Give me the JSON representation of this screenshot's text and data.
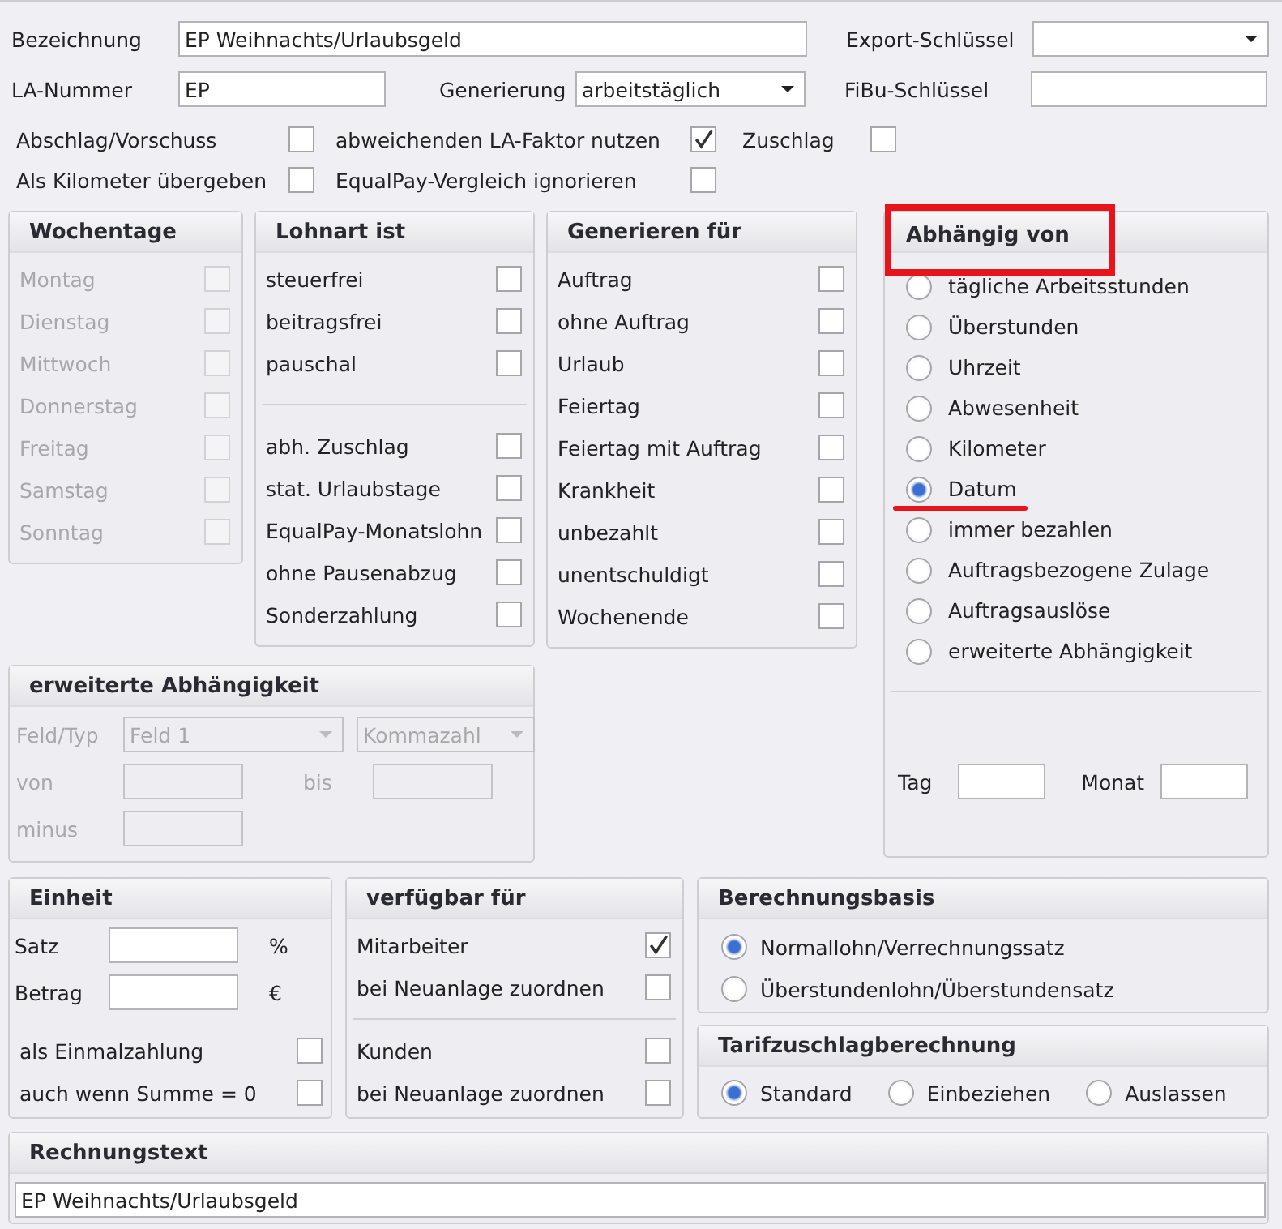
{
  "top": {
    "bezeichnung": {
      "label": "Bezeichnung",
      "value": "EP Weihnachts/Urlaubsgeld"
    },
    "export_schluessel": {
      "label": "Export-Schlüssel"
    },
    "la_nummer": {
      "label": "LA-Nummer",
      "value": "EP"
    },
    "generierung": {
      "label": "Generierung",
      "value": "arbeitstäglich"
    },
    "fibu_schluessel": {
      "label": "FiBu-Schlüssel"
    },
    "options": [
      {
        "label": "Abschlag/Vorschuss",
        "checked": false
      },
      {
        "label": "abweichenden LA-Faktor nutzen",
        "checked": true
      },
      {
        "label": "Zuschlag",
        "checked": false
      },
      {
        "label": "Als Kilometer übergeben",
        "checked": false
      },
      {
        "label": "EqualPay-Vergleich ignorieren",
        "checked": false
      }
    ]
  },
  "wochentage": {
    "title": "Wochentage",
    "items": [
      {
        "label": "Montag",
        "checked": false,
        "disabled": true
      },
      {
        "label": "Dienstag",
        "checked": false,
        "disabled": true
      },
      {
        "label": "Mittwoch",
        "checked": false,
        "disabled": true
      },
      {
        "label": "Donnerstag",
        "checked": false,
        "disabled": true
      },
      {
        "label": "Freitag",
        "checked": false,
        "disabled": true
      },
      {
        "label": "Samstag",
        "checked": false,
        "disabled": true
      },
      {
        "label": "Sonntag",
        "checked": false,
        "disabled": true
      }
    ]
  },
  "lohnart_ist": {
    "title": "Lohnart ist",
    "sections": [
      {
        "items": [
          {
            "label": "steuerfrei",
            "checked": false,
            "disabled": false
          },
          {
            "label": "beitragsfrei",
            "checked": false,
            "disabled": false
          },
          {
            "label": "pauschal",
            "checked": false,
            "disabled": false
          }
        ]
      },
      {
        "items": [
          {
            "label": "abh. Zuschlag",
            "checked": false,
            "disabled": false
          },
          {
            "label": "stat. Urlaubstage",
            "checked": false,
            "disabled": false
          },
          {
            "label": "EqualPay-Monatslohn",
            "checked": false,
            "disabled": false
          },
          {
            "label": "ohne Pausenabzug",
            "checked": false,
            "disabled": false
          },
          {
            "label": "Sonderzahlung",
            "checked": false,
            "disabled": false
          }
        ]
      }
    ]
  },
  "generieren_fuer": {
    "title": "Generieren für",
    "items": [
      {
        "label": "Auftrag",
        "checked": false,
        "disabled": false
      },
      {
        "label": "ohne Auftrag",
        "checked": false,
        "disabled": false
      },
      {
        "label": "Urlaub",
        "checked": false,
        "disabled": false
      },
      {
        "label": "Feiertag",
        "checked": false,
        "disabled": false
      },
      {
        "label": "Feiertag mit Auftrag",
        "checked": false,
        "disabled": false
      },
      {
        "label": "Krankheit",
        "checked": false,
        "disabled": false
      },
      {
        "label": "unbezahlt",
        "checked": false,
        "disabled": false
      },
      {
        "label": "unentschuldigt",
        "checked": false,
        "disabled": false
      },
      {
        "label": "Wochenende",
        "checked": false,
        "disabled": false
      }
    ]
  },
  "abhaengig_von": {
    "title": "Abhängig von",
    "title_highlighted": true,
    "options": [
      {
        "label": "tägliche Arbeitsstunden",
        "selected": false,
        "underlined": false
      },
      {
        "label": "Überstunden",
        "selected": false,
        "underlined": false
      },
      {
        "label": "Uhrzeit",
        "selected": false,
        "underlined": false
      },
      {
        "label": "Abwesenheit",
        "selected": false,
        "underlined": false
      },
      {
        "label": "Kilometer",
        "selected": false,
        "underlined": false
      },
      {
        "label": "Datum",
        "selected": true,
        "underlined": true
      },
      {
        "label": "immer bezahlen",
        "selected": false,
        "underlined": false
      },
      {
        "label": "Auftragsbezogene Zulage",
        "selected": false,
        "underlined": false
      },
      {
        "label": "Auftragsauslöse",
        "selected": false,
        "underlined": false
      },
      {
        "label": "erweiterte Abhängigkeit",
        "selected": false,
        "underlined": false
      }
    ],
    "tag": {
      "label": "Tag"
    },
    "monat": {
      "label": "Monat"
    }
  },
  "erweiterte_abhaengigkeit": {
    "title": "erweiterte Abhängigkeit",
    "disabled": true,
    "feld_typ_label": "Feld/Typ",
    "feld": "Feld 1",
    "typ": "Kommazahl",
    "von_label": "von",
    "bis_label": "bis",
    "minus_label": "minus"
  },
  "einheit": {
    "title": "Einheit",
    "satz": {
      "label": "Satz",
      "unit": "%"
    },
    "betrag": {
      "label": "Betrag",
      "unit": "€"
    },
    "items": [
      {
        "label": "als Einmalzahlung",
        "checked": false,
        "disabled": false
      },
      {
        "label": "auch wenn Summe = 0",
        "checked": false,
        "disabled": false
      }
    ]
  },
  "verfuegbar_fuer": {
    "title": "verfügbar für",
    "sections": [
      {
        "items": [
          {
            "label": "Mitarbeiter",
            "checked": true,
            "disabled": false
          },
          {
            "label": "bei Neuanlage zuordnen",
            "checked": false,
            "disabled": false
          }
        ]
      },
      {
        "items": [
          {
            "label": "Kunden",
            "checked": false,
            "disabled": false
          },
          {
            "label": "bei Neuanlage zuordnen",
            "checked": false,
            "disabled": false
          }
        ]
      }
    ]
  },
  "berechnungsbasis": {
    "title": "Berechnungsbasis",
    "options": [
      {
        "label": "Normallohn/Verrechnungssatz",
        "selected": true
      },
      {
        "label": "Überstundenlohn/Überstundensatz",
        "selected": false
      }
    ]
  },
  "tarifzuschlagberechnung": {
    "title": "Tarifzuschlagberechnung",
    "options": [
      {
        "label": "Standard",
        "selected": true
      },
      {
        "label": "Einbeziehen",
        "selected": false
      },
      {
        "label": "Auslassen",
        "selected": false
      }
    ]
  },
  "rechnungstext": {
    "title": "Rechnungstext",
    "value": "EP Weihnachts/Urlaubsgeld"
  }
}
